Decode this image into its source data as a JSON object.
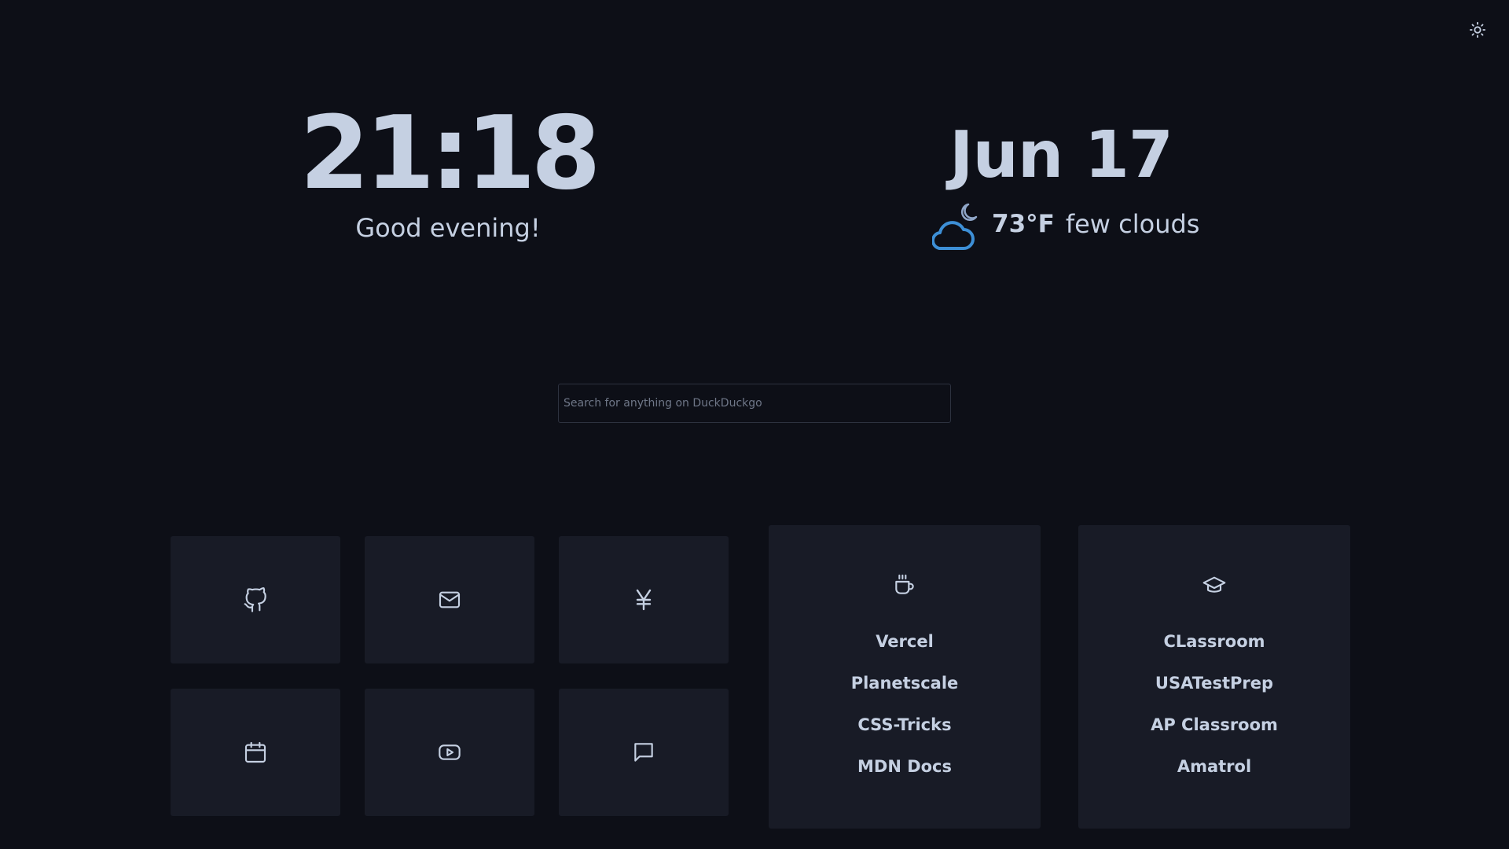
{
  "clock": {
    "time": "21:18",
    "greeting": "Good evening!"
  },
  "date": {
    "text": "Jun 17"
  },
  "weather": {
    "temp": "73°F",
    "description": "few clouds",
    "icon": "cloud-moon-icon"
  },
  "search": {
    "placeholder": "Search for anything on DuckDuckgo",
    "value": ""
  },
  "tiles": [
    {
      "icon": "github-icon"
    },
    {
      "icon": "mail-icon"
    },
    {
      "icon": "yen-icon"
    },
    {
      "icon": "calendar-icon"
    },
    {
      "icon": "youtube-icon"
    },
    {
      "icon": "message-icon"
    }
  ],
  "dev_links": {
    "icon": "coffee-icon",
    "items": [
      "Vercel",
      "Planetscale",
      "CSS-Tricks",
      "MDN Docs"
    ]
  },
  "school_links": {
    "icon": "graduation-cap-icon",
    "items": [
      "CLassroom",
      "USATestPrep",
      "AP Classroom",
      "Amatrol"
    ]
  },
  "colors": {
    "background": "#0d0f17",
    "card": "#181b26",
    "text": "#c5d0e2",
    "accent": "#3d8fd6"
  }
}
